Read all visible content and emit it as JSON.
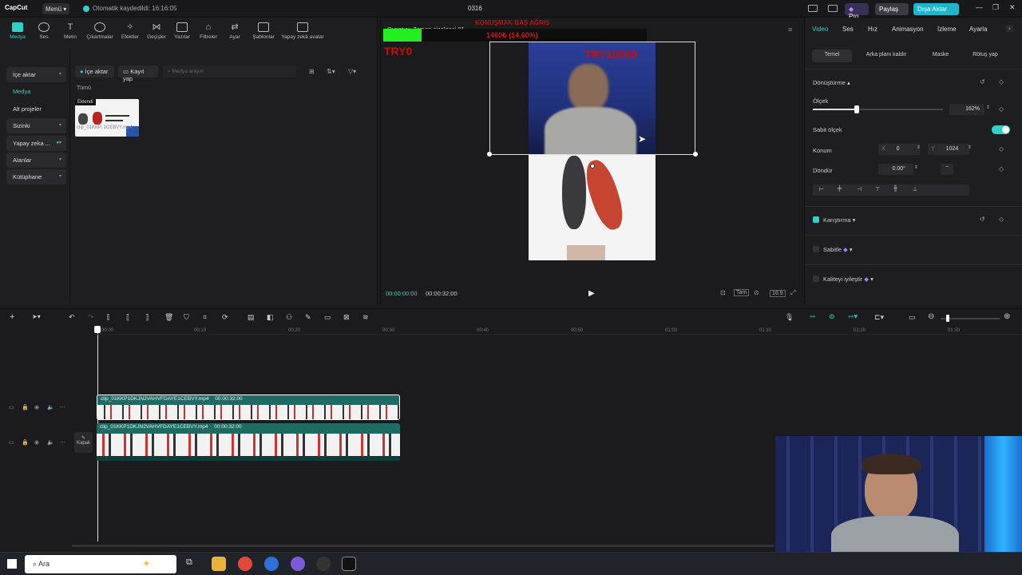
{
  "titlebar": {
    "app_name": "CapCut",
    "menu_label": "Menü",
    "save_status": "Otomatik kaydedildi: 16:16:05",
    "project_title": "0316",
    "pro_label": "Pro",
    "share_label": "Paylaş",
    "export_label": "Dışa Aktar"
  },
  "toolbar": {
    "items": [
      "Medya",
      "Ses",
      "Metin",
      "Çıkartmalar",
      "Efektler",
      "Geçişler",
      "Yazılar",
      "Filtreler",
      "Ayar",
      "Şablonlar",
      "Yapay zekâ avatar"
    ]
  },
  "sidebar": {
    "items": [
      "İçe aktar",
      "Medya",
      "Alt projeler",
      "Sizinki",
      "Yapay zeka ...",
      "Alanlar",
      "Kütüphane"
    ]
  },
  "media": {
    "import_label": "İçe aktar",
    "record_label": "Kayıt yap",
    "search_placeholder": "Medya arayın",
    "filter_label": "Tümü",
    "clip_badge": "Eklendi",
    "clip_name": "clip_01KKP..1CEBVY.mp4"
  },
  "preview": {
    "player_title": "Oynatıcı: Zaman çizelgesi 01",
    "overlay_top": "KONUŞMAK BAŞ AĞRIS",
    "overlay_percent": "1460₺ (14,60%)",
    "overlay_left": "TRY0",
    "overlay_right": "TRY10000",
    "progress_value": 0.146,
    "time_current": "00:00:00:00",
    "time_total": "00:00:32:00",
    "ratio_label": "Tam",
    "aspect_label": "16:9"
  },
  "inspector": {
    "tabs": [
      "Video",
      "Ses",
      "Hız",
      "Animasyon",
      "İzleme",
      "Ayarla"
    ],
    "subtabs": [
      "Temel",
      "Arka planı kaldır",
      "Maske",
      "Rötuş yap"
    ],
    "transform_label": "Dönüştürme",
    "scale_label": "Ölçek",
    "scale_value": "162%",
    "uniform_label": "Sabit ölçek",
    "position_label": "Konum",
    "x_label": "X",
    "x_value": "0",
    "y_label": "Y",
    "y_value": "1024",
    "rotate_label": "Döndür",
    "rotate_value": "0.00°",
    "blend_label": "Karıştırma",
    "stabilize_label": "Sabitle",
    "enhance_label": "Kaliteyi iyileştir"
  },
  "timeline": {
    "ruler": [
      "00:00",
      "00:10",
      "00:20",
      "00:30",
      "00:40",
      "00:50",
      "01:00",
      "01:10",
      "01:20",
      "01:30"
    ],
    "clip1_label": "clip_01KKP1DKJN2VAHVFDAYE1CEBVY.mp4",
    "clip1_duration": "00:00:32:00",
    "clip2_label": "clip_01KKP1DKJN2VAHVFDAYE1CEBVY.mp4",
    "clip2_duration": "00:00:32:00",
    "cover_label": "Kapak"
  },
  "taskbar": {
    "search_placeholder": "Ara"
  },
  "colors": {
    "accent": "#2fd0c8",
    "clip": "#1e6b64",
    "export": "#1fb6c9"
  }
}
